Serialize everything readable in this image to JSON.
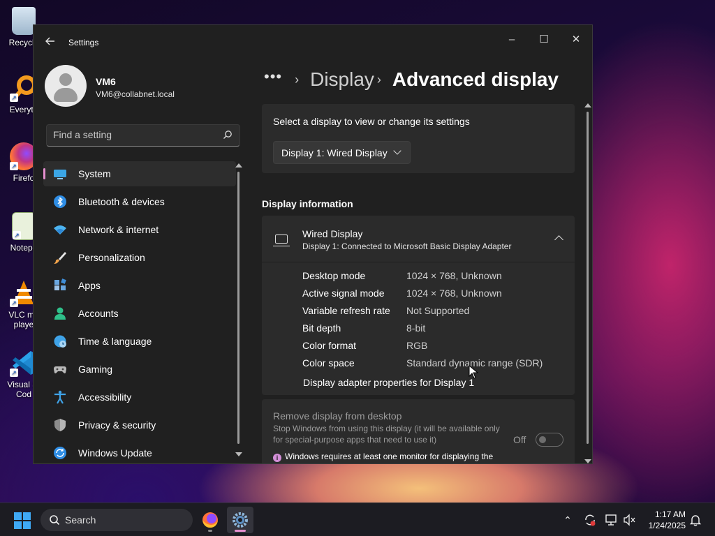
{
  "desktop": {
    "icons": [
      {
        "label": "Recycle",
        "icon": "recycle-bin-icon"
      },
      {
        "label": "Everyth",
        "icon": "everything-search-icon"
      },
      {
        "label": "Firefo",
        "icon": "firefox-icon"
      },
      {
        "label": "Notepa",
        "icon": "notepad-icon"
      },
      {
        "label": "VLC me\nplaye",
        "icon": "vlc-icon"
      },
      {
        "label": "Visual St\nCod",
        "icon": "vscode-icon"
      }
    ]
  },
  "window": {
    "title": "Settings",
    "controls": {
      "minimize": "–",
      "maximize": "☐",
      "close": "✕"
    }
  },
  "user": {
    "name": "VM6",
    "email": "VM6@collabnet.local"
  },
  "search": {
    "placeholder": "Find a setting"
  },
  "nav": {
    "items": [
      {
        "label": "System",
        "icon": "system-icon",
        "active": true
      },
      {
        "label": "Bluetooth & devices",
        "icon": "bluetooth-icon"
      },
      {
        "label": "Network & internet",
        "icon": "wifi-icon"
      },
      {
        "label": "Personalization",
        "icon": "brush-icon"
      },
      {
        "label": "Apps",
        "icon": "apps-icon"
      },
      {
        "label": "Accounts",
        "icon": "accounts-icon"
      },
      {
        "label": "Time & language",
        "icon": "globe-clock-icon"
      },
      {
        "label": "Gaming",
        "icon": "gamepad-icon"
      },
      {
        "label": "Accessibility",
        "icon": "accessibility-icon"
      },
      {
        "label": "Privacy & security",
        "icon": "shield-icon"
      },
      {
        "label": "Windows Update",
        "icon": "update-icon"
      }
    ]
  },
  "breadcrumb": {
    "more": "•••",
    "items": [
      "Display",
      "Advanced display"
    ]
  },
  "select_display": {
    "label": "Select a display to view or change its settings",
    "value": "Display 1: Wired Display"
  },
  "display_info": {
    "section_title": "Display information",
    "name": "Wired Display",
    "subtitle": "Display 1: Connected to Microsoft Basic Display Adapter",
    "properties": [
      {
        "key": "Desktop mode",
        "value": "1024 × 768, Unknown"
      },
      {
        "key": "Active signal mode",
        "value": "1024 × 768, Unknown"
      },
      {
        "key": "Variable refresh rate",
        "value": "Not Supported"
      },
      {
        "key": "Bit depth",
        "value": "8-bit"
      },
      {
        "key": "Color format",
        "value": "RGB"
      },
      {
        "key": "Color space",
        "value": "Standard dynamic range (SDR)"
      }
    ],
    "adapter_link": "Display adapter properties for Display 1"
  },
  "remove_display": {
    "title": "Remove display from desktop",
    "description": "Stop Windows from using this display (it will be available only for special-purpose apps that need to use it)",
    "toggle_label": "Off",
    "note": "Windows requires at least one monitor for displaying the desktop"
  },
  "taskbar": {
    "search_label": "Search",
    "time": "1:17 AM",
    "date": "1/24/2025"
  },
  "colors": {
    "accent": "#e58fcf",
    "window_bg": "#202020",
    "card_bg": "#2b2b2b"
  }
}
